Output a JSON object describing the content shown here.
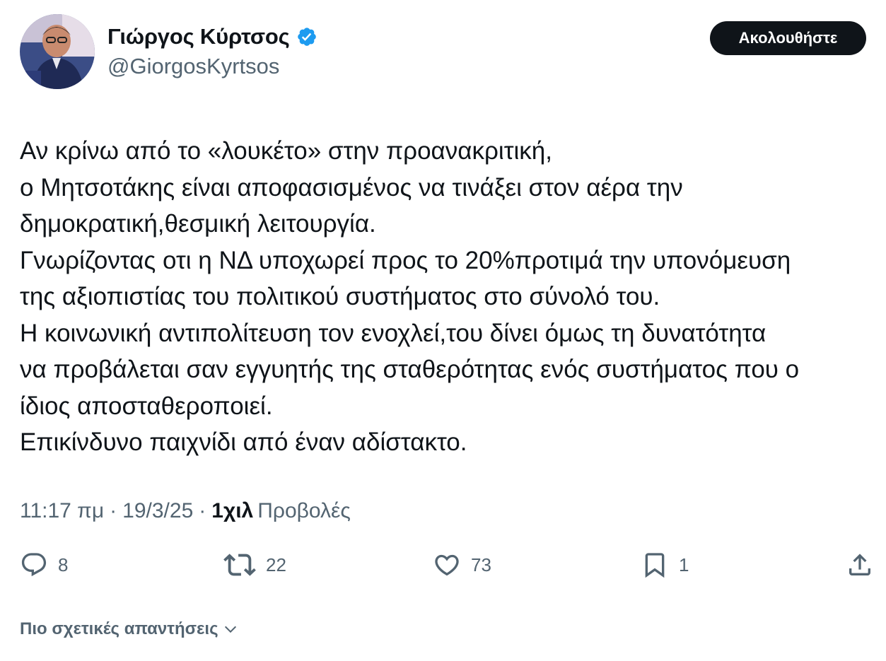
{
  "author": {
    "display_name": "Γιώργος Κύρτσος",
    "handle": "@GiorgosKyrtsos",
    "verified": true,
    "avatar_icon": "profile-photo"
  },
  "follow_button": {
    "label": "Ακολουθήστε"
  },
  "tweet": {
    "lines": [
      "Αν κρίνω από το «λουκέτο» στην προανακριτική,",
      "ο Μητσοτάκης είναι αποφασισμένος να τινάξει στον αέρα την",
      "δημοκρατική,θεσμική λειτουργία.",
      "Γνωρίζοντας οτι η ΝΔ υποχωρεί προς το 20%προτιμά την υπονόμευση",
      "της αξιοπιστίας του πολιτικού συστήματος στο σύνολό του.",
      "Η κοινωνική αντιπολίτευση τον ενοχλεί,του δίνει όμως τη δυνατότητα",
      "να προβάλεται σαν εγγυητής της σταθερότητας ενός συστήματος που ο",
      "ίδιος αποσταθεροποιεί.",
      "Επικίνδυνο παιχνίδι από έναν αδίστακτο."
    ]
  },
  "meta": {
    "time": "11:17 πμ",
    "separator": "·",
    "date": "19/3/25",
    "views_count": "1χιλ",
    "views_label": "Προβολές"
  },
  "actions": {
    "replies": "8",
    "reposts": "22",
    "likes": "73",
    "bookmarks": "1"
  },
  "more_replies": {
    "label": "Πιο σχετικές απαντήσεις"
  },
  "colors": {
    "text_primary": "#0f1419",
    "text_secondary": "#536471",
    "verified_blue": "#1d9bf0",
    "button_bg": "#0f1419",
    "button_text": "#ffffff"
  }
}
